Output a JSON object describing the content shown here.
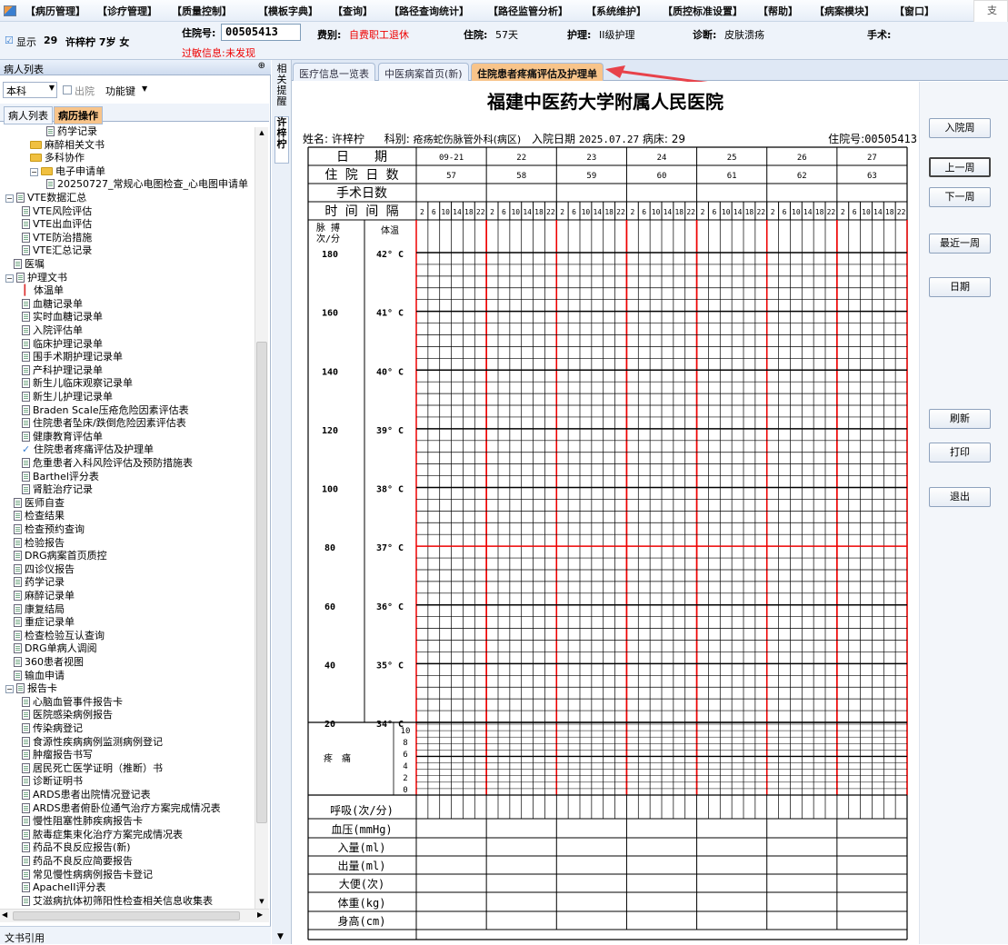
{
  "menu": [
    "【病历管理】",
    "【诊疗管理】",
    "【质量控制】",
    "【模板字典】",
    "【查询】",
    "【路径查询统计】",
    "【路径监管分析】",
    "【系统维护】",
    "【质控标准设置】",
    "【帮助】",
    "【病案模块】",
    "【窗口】"
  ],
  "menu_more": "支",
  "infobar": {
    "show_check": "☑",
    "show_label": "显示",
    "bed": "29",
    "name_age_sex": "许梓柠 7岁 女",
    "inpatient_no_label": "住院号:",
    "inpatient_no": "00505413",
    "allergy_label": "过敏信息:",
    "allergy_value": "未发现",
    "fee_label": "费别:",
    "fee_value": "自费职工退休",
    "stay_label": "住院:",
    "stay_value": "57天",
    "nursing_label": "护理:",
    "nursing_value": "II级护理",
    "diagnosis_label": "诊断:",
    "diagnosis_value": "皮肤溃疡",
    "surgery_label": "手术:"
  },
  "left_panel": {
    "title": "病人列表",
    "pin": "⊕",
    "dept": "本科",
    "discharge_label": "出院",
    "func_key": "功能键",
    "tab_patients": "病人列表",
    "tab_records": "病历操作",
    "bottom_label": "文书引用",
    "tree": [
      {
        "indent": 5,
        "type": "doc",
        "label": "药学记录"
      },
      {
        "indent": 3,
        "type": "folder",
        "label": "麻醉相关文书"
      },
      {
        "indent": 3,
        "type": "folder",
        "label": "多科协作"
      },
      {
        "indent": 3,
        "type": "folder-exp",
        "label": "电子申请单"
      },
      {
        "indent": 5,
        "type": "doc",
        "label": "20250727_常规心电图检查_心电图申请单"
      },
      {
        "indent": 0,
        "type": "doc-exp",
        "label": "VTE数据汇总"
      },
      {
        "indent": 2,
        "type": "doc",
        "label": "VTE风险评估"
      },
      {
        "indent": 2,
        "type": "doc",
        "label": "VTE出血评估"
      },
      {
        "indent": 2,
        "type": "doc",
        "label": "VTE防治措施"
      },
      {
        "indent": 2,
        "type": "doc",
        "label": "VTE汇总记录"
      },
      {
        "indent": 1,
        "type": "doc",
        "label": "医嘱"
      },
      {
        "indent": 0,
        "type": "doc-exp",
        "label": "护理文书"
      },
      {
        "indent": 2,
        "type": "therm",
        "label": "体温单"
      },
      {
        "indent": 2,
        "type": "doc",
        "label": "血糖记录单"
      },
      {
        "indent": 2,
        "type": "doc",
        "label": "实时血糖记录单"
      },
      {
        "indent": 2,
        "type": "doc",
        "label": "入院评估单"
      },
      {
        "indent": 2,
        "type": "doc",
        "label": "临床护理记录单"
      },
      {
        "indent": 2,
        "type": "doc",
        "label": "围手术期护理记录单"
      },
      {
        "indent": 2,
        "type": "doc",
        "label": "产科护理记录单"
      },
      {
        "indent": 2,
        "type": "doc",
        "label": "新生儿临床观察记录单"
      },
      {
        "indent": 2,
        "type": "doc",
        "label": "新生儿护理记录单"
      },
      {
        "indent": 2,
        "type": "doc",
        "label": "Braden Scale压疮危险因素评估表"
      },
      {
        "indent": 2,
        "type": "doc",
        "label": "住院患者坠床/跌倒危险因素评估表"
      },
      {
        "indent": 2,
        "type": "doc",
        "label": "健康教育评估单"
      },
      {
        "indent": 2,
        "type": "check",
        "label": "住院患者疼痛评估及护理单"
      },
      {
        "indent": 2,
        "type": "doc",
        "label": "危重患者入科风险评估及预防措施表"
      },
      {
        "indent": 2,
        "type": "doc",
        "label": "Barthel评分表"
      },
      {
        "indent": 2,
        "type": "doc",
        "label": "肾脏治疗记录"
      },
      {
        "indent": 1,
        "type": "doc",
        "label": "医师自查"
      },
      {
        "indent": 1,
        "type": "doc",
        "label": "检查结果"
      },
      {
        "indent": 1,
        "type": "doc",
        "label": "检查预约查询"
      },
      {
        "indent": 1,
        "type": "doc",
        "label": "检验报告"
      },
      {
        "indent": 1,
        "type": "doc",
        "label": "DRG病案首页质控"
      },
      {
        "indent": 1,
        "type": "doc",
        "label": "四诊仪报告"
      },
      {
        "indent": 1,
        "type": "doc",
        "label": "药学记录"
      },
      {
        "indent": 1,
        "type": "doc",
        "label": "麻醉记录单"
      },
      {
        "indent": 1,
        "type": "doc",
        "label": "康复结局"
      },
      {
        "indent": 1,
        "type": "doc",
        "label": "重症记录单"
      },
      {
        "indent": 1,
        "type": "doc",
        "label": "检查检验互认查询"
      },
      {
        "indent": 1,
        "type": "doc",
        "label": "DRG单病人调阅"
      },
      {
        "indent": 1,
        "type": "doc",
        "label": "360患者视图"
      },
      {
        "indent": 1,
        "type": "doc",
        "label": "输血申请"
      },
      {
        "indent": 0,
        "type": "doc-exp",
        "label": "报告卡"
      },
      {
        "indent": 2,
        "type": "doc",
        "label": "心脑血管事件报告卡"
      },
      {
        "indent": 2,
        "type": "doc",
        "label": "医院感染病例报告"
      },
      {
        "indent": 2,
        "type": "doc",
        "label": "传染病登记"
      },
      {
        "indent": 2,
        "type": "doc",
        "label": "食源性疾病病例监测病例登记"
      },
      {
        "indent": 2,
        "type": "doc",
        "label": "肿瘤报告书写"
      },
      {
        "indent": 2,
        "type": "doc",
        "label": "居民死亡医学证明（推断）书"
      },
      {
        "indent": 2,
        "type": "doc",
        "label": "诊断证明书"
      },
      {
        "indent": 2,
        "type": "doc",
        "label": "ARDS患者出院情况登记表"
      },
      {
        "indent": 2,
        "type": "doc",
        "label": "ARDS患者俯卧位通气治疗方案完成情况表"
      },
      {
        "indent": 2,
        "type": "doc",
        "label": "慢性阻塞性肺疾病报告卡"
      },
      {
        "indent": 2,
        "type": "doc",
        "label": "脓毒症集束化治疗方案完成情况表"
      },
      {
        "indent": 2,
        "type": "doc",
        "label": "药品不良反应报告(新)"
      },
      {
        "indent": 2,
        "type": "doc",
        "label": "药品不良反应简要报告"
      },
      {
        "indent": 2,
        "type": "doc",
        "label": "常见慢性病病例报告卡登记"
      },
      {
        "indent": 2,
        "type": "doc",
        "label": "ApacheII评分表"
      },
      {
        "indent": 2,
        "type": "doc",
        "label": "艾滋病抗体初筛阳性检查相关信息收集表"
      }
    ]
  },
  "sidetabs": {
    "tab1": "相关提醒",
    "tab2": "许梓柠"
  },
  "tabs": [
    "医疗信息一览表",
    "中医病案首页(新)",
    "住院患者疼痛评估及护理单"
  ],
  "active_tab": 2,
  "document": {
    "hospital": "福建中医药大学附属人民医院",
    "name_label": "姓名:",
    "name": "许梓柠",
    "dept_label": "科别:",
    "dept": "疮疡蛇伤脉管外科(病区)",
    "admit_label": "入院日期",
    "admit_date": "2025.07.27",
    "bed_label": "病床:",
    "bed": "29",
    "no_label": "住院号:",
    "no": "00505413",
    "row_date": "日　　期",
    "row_days": "住 院 日 数",
    "row_surgery": "手术日数",
    "row_interval": "时 间 间 隔",
    "dates": [
      "09-21",
      "22",
      "23",
      "24",
      "25",
      "26",
      "27"
    ],
    "days": [
      "57",
      "58",
      "59",
      "60",
      "61",
      "62",
      "63"
    ],
    "hours": [
      "2",
      "6",
      "10",
      "14",
      "18",
      "22"
    ],
    "pulse_label1": "脉 搏",
    "pulse_label2": "次/分",
    "temp_label": "体温",
    "pulse_ticks": [
      "180",
      "160",
      "140",
      "120",
      "100",
      "80",
      "60",
      "40",
      "20"
    ],
    "temp_ticks": [
      "42° C",
      "41° C",
      "40° C",
      "39° C",
      "38° C",
      "37° C",
      "36° C",
      "35° C",
      "34° C"
    ],
    "pain_label": "疼　痛",
    "pain_ticks": [
      "10",
      "8",
      "6",
      "4",
      "2",
      "0"
    ],
    "bottom_rows": [
      "呼吸(次/分)",
      "血压(mmHg)",
      "入量(ml)",
      "出量(ml)",
      "大便(次)",
      "体重(kg)",
      "身高(cm)"
    ]
  },
  "right_buttons": [
    "入院周",
    "上一周",
    "下一周",
    "最近一周",
    "日期",
    "刷新",
    "打印",
    "退出"
  ]
}
